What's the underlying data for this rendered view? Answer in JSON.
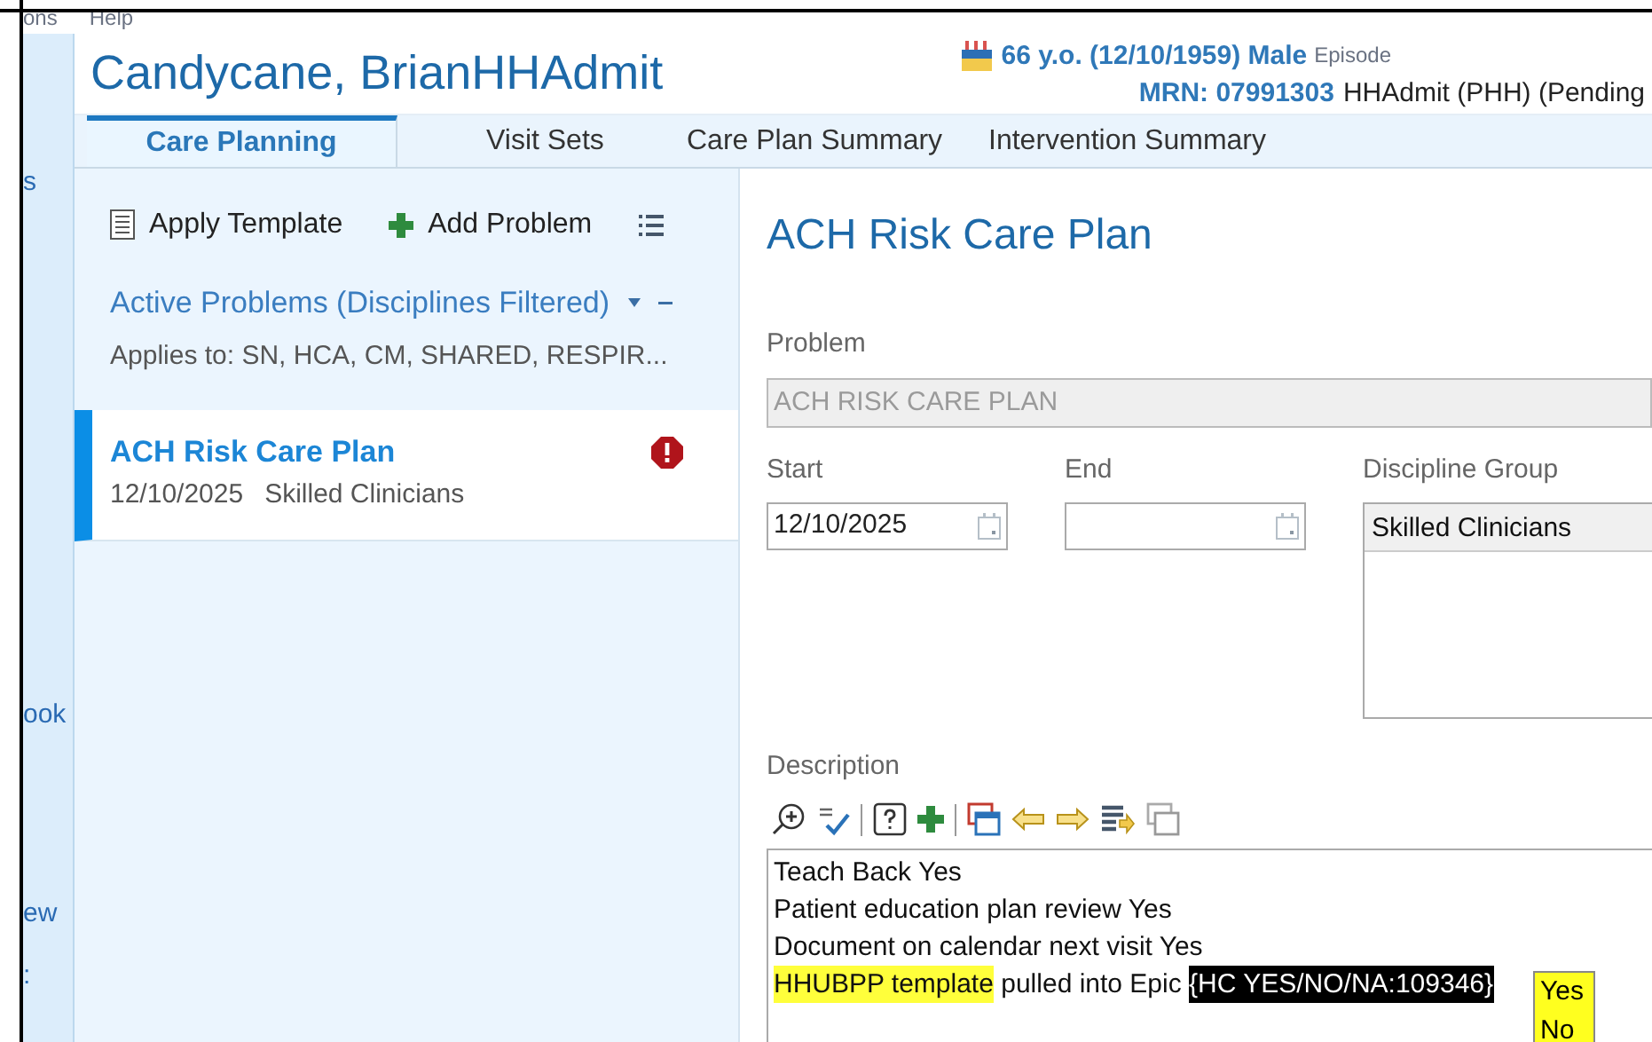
{
  "menu": [
    "ons",
    "Help"
  ],
  "nav": [
    "s",
    "ook",
    "ew",
    ":"
  ],
  "patient": {
    "name": "Candycane, BrianHHAdmit",
    "age_line": "66 y.o. (12/10/1959) Male",
    "episode": "Episode",
    "mrn": "MRN: 07991303",
    "encounter": "HHAdmit (PHH) (Pending"
  },
  "tabs": [
    {
      "label": "Care Planning",
      "selected": true
    },
    {
      "label": "Visit Sets",
      "selected": false
    },
    {
      "label": "Care Plan Summary",
      "selected": false
    },
    {
      "label": "Intervention Summary",
      "selected": false
    }
  ],
  "toolbar": [
    "Apply Template",
    "Add Problem"
  ],
  "problems_header": {
    "title": "Active Problems (Disciplines Filtered)",
    "applies_to": "Applies to: SN, HCA, CM, SHARED, RESPIR..."
  },
  "problems": [
    {
      "name": "ACH Risk Care Plan",
      "date": "12/10/2025",
      "discipline": "Skilled Clinicians",
      "selected": true,
      "alert": true
    }
  ],
  "detail": {
    "title": "ACH Risk Care Plan",
    "problem": {
      "label": "Problem",
      "value": "ACH RISK CARE PLAN",
      "disabled": true
    },
    "start": {
      "label": "Start",
      "value": "12/10/2025"
    },
    "end": {
      "label": "End"
    },
    "discipline_group": {
      "label": "Discipline Group",
      "items": [
        "Skilled Clinicians"
      ]
    },
    "description": {
      "label": "Description",
      "lines": [
        {
          "kind": "plain",
          "text": "Teach Back Yes"
        },
        {
          "kind": "plain",
          "text": "Patient education plan review Yes"
        },
        {
          "kind": "plain",
          "text": "Document on calendar next visit Yes"
        },
        {
          "kind": "template",
          "highlight": "HHUBPP template",
          "text": " pulled into Epic ",
          "field": "{HC YES/NO/NA:109346}"
        }
      ],
      "popup": [
        "Yes",
        "No"
      ]
    }
  }
}
